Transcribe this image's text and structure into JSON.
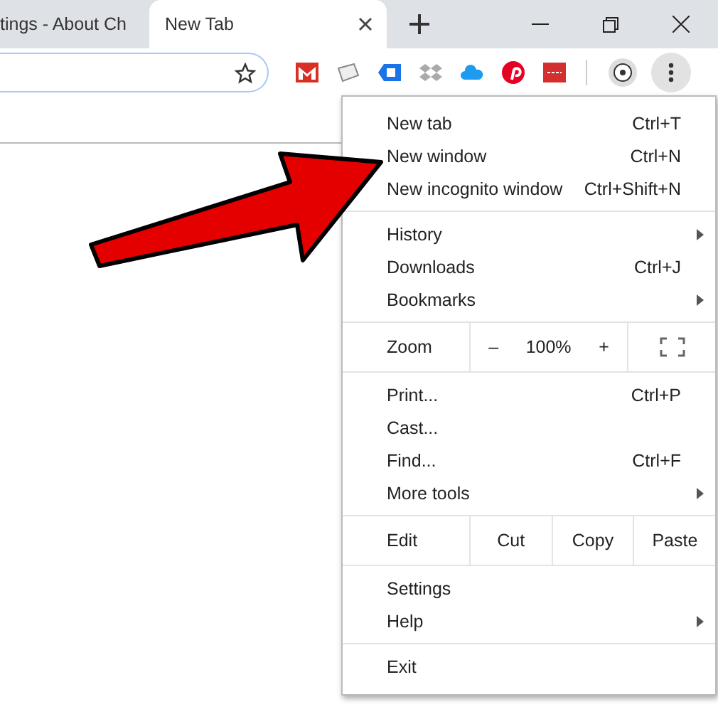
{
  "tabs": [
    {
      "label": "tings - About Ch",
      "selected": false
    },
    {
      "label": "New Tab",
      "selected": true
    }
  ],
  "menu": {
    "sections": [
      {
        "items": [
          {
            "kind": "item",
            "label": "New tab",
            "shortcut": "Ctrl+T",
            "submenu": false
          },
          {
            "kind": "item",
            "label": "New window",
            "shortcut": "Ctrl+N",
            "submenu": false
          },
          {
            "kind": "item",
            "label": "New incognito window",
            "shortcut": "Ctrl+Shift+N",
            "submenu": false
          }
        ]
      },
      {
        "items": [
          {
            "kind": "item",
            "label": "History",
            "submenu": true
          },
          {
            "kind": "item",
            "label": "Downloads",
            "shortcut": "Ctrl+J",
            "submenu": false
          },
          {
            "kind": "item",
            "label": "Bookmarks",
            "submenu": true
          }
        ]
      },
      {
        "items": [
          {
            "kind": "zoom",
            "label": "Zoom",
            "minus": "–",
            "value": "100%",
            "plus": "+"
          }
        ]
      },
      {
        "items": [
          {
            "kind": "item",
            "label": "Print...",
            "shortcut": "Ctrl+P",
            "submenu": false
          },
          {
            "kind": "item",
            "label": "Cast...",
            "submenu": false
          },
          {
            "kind": "item",
            "label": "Find...",
            "shortcut": "Ctrl+F",
            "submenu": false
          },
          {
            "kind": "item",
            "label": "More tools",
            "submenu": true
          }
        ]
      },
      {
        "items": [
          {
            "kind": "edit",
            "label": "Edit",
            "cut": "Cut",
            "copy": "Copy",
            "paste": "Paste"
          }
        ]
      },
      {
        "items": [
          {
            "kind": "item",
            "label": "Settings",
            "submenu": false
          },
          {
            "kind": "item",
            "label": "Help",
            "submenu": true
          }
        ]
      },
      {
        "items": [
          {
            "kind": "item",
            "label": "Exit",
            "submenu": false
          }
        ]
      }
    ]
  }
}
